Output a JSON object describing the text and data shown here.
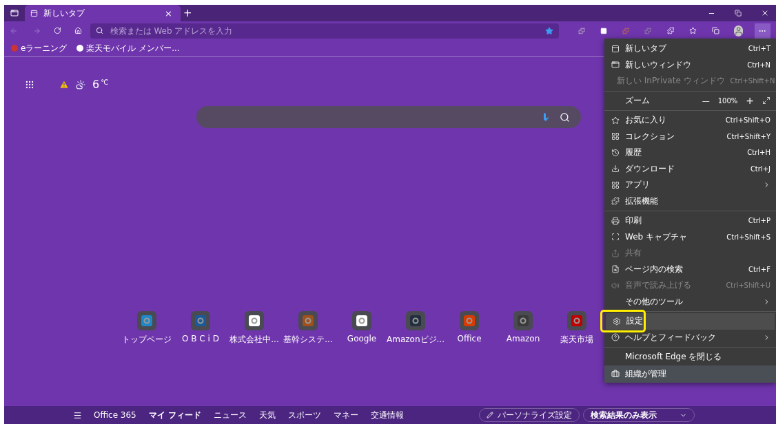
{
  "tab": {
    "title": "新しいタブ",
    "close": "×",
    "new": "+"
  },
  "address_bar": {
    "placeholder": "検索または Web アドレスを入力"
  },
  "favorites": [
    {
      "label": "eラーニング"
    },
    {
      "label": "楽天モバイル メンバー..."
    }
  ],
  "weather": {
    "temperature": "6",
    "unit": "℃"
  },
  "top_sites": [
    {
      "label": "トップページ",
      "color": "#1e88c8"
    },
    {
      "label": "O B C i D",
      "color": "#1a5a9a"
    },
    {
      "label": "株式会社中...",
      "color": "#ffffff"
    },
    {
      "label": "基幹システ...",
      "color": "#a0501a"
    },
    {
      "label": "Google",
      "color": "#ffffff"
    },
    {
      "label": "Amazonビジ...",
      "color": "#232f3e"
    },
    {
      "label": "Office",
      "color": "#d83b01"
    },
    {
      "label": "Amazon",
      "color": "#3a3a3a"
    },
    {
      "label": "楽天市場",
      "color": "#bf0000"
    }
  ],
  "menu": [
    {
      "kind": "item",
      "label": "新しいタブ",
      "shortcut": "Ctrl+T",
      "disabled": false,
      "selected": false
    },
    {
      "kind": "item",
      "label": "新しいウィンドウ",
      "shortcut": "Ctrl+N",
      "disabled": false,
      "selected": false
    },
    {
      "kind": "item",
      "label": "新しい InPrivate ウィンドウ",
      "shortcut": "Ctrl+Shift+N",
      "disabled": true,
      "selected": false
    },
    {
      "kind": "divider"
    },
    {
      "kind": "zoom",
      "label": "ズーム",
      "minus": "—",
      "value": "100%",
      "plus": "+"
    },
    {
      "kind": "divider"
    },
    {
      "kind": "item",
      "label": "お気に入り",
      "shortcut": "Ctrl+Shift+O",
      "disabled": false,
      "selected": false
    },
    {
      "kind": "item",
      "label": "コレクション",
      "shortcut": "Ctrl+Shift+Y",
      "disabled": false,
      "selected": false
    },
    {
      "kind": "item",
      "label": "履歴",
      "shortcut": "Ctrl+H",
      "disabled": false,
      "selected": false
    },
    {
      "kind": "item",
      "label": "ダウンロード",
      "shortcut": "Ctrl+J",
      "disabled": false,
      "selected": false
    },
    {
      "kind": "submenu",
      "label": "アプリ",
      "disabled": false,
      "selected": false
    },
    {
      "kind": "item",
      "label": "拡張機能",
      "disabled": false,
      "selected": false
    },
    {
      "kind": "divider"
    },
    {
      "kind": "item",
      "label": "印刷",
      "shortcut": "Ctrl+P",
      "disabled": false,
      "selected": false
    },
    {
      "kind": "item",
      "label": "Web キャプチャ",
      "shortcut": "Ctrl+Shift+S",
      "disabled": false,
      "selected": false
    },
    {
      "kind": "item",
      "label": "共有",
      "disabled": true,
      "selected": false
    },
    {
      "kind": "item",
      "label": "ページ内の検索",
      "shortcut": "Ctrl+F",
      "disabled": false,
      "selected": false
    },
    {
      "kind": "item",
      "label": "音声で読み上げる",
      "shortcut": "Ctrl+Shift+U",
      "disabled": true,
      "selected": false
    },
    {
      "kind": "submenu",
      "label": "その他のツール",
      "disabled": false,
      "selected": false
    },
    {
      "kind": "divider"
    },
    {
      "kind": "item",
      "label": "設定",
      "disabled": false,
      "selected": true
    },
    {
      "kind": "submenu",
      "label": "ヘルプとフィードバック",
      "disabled": false,
      "selected": false
    },
    {
      "kind": "divider"
    },
    {
      "kind": "item",
      "label": "Microsoft Edge を閉じる",
      "disabled": false,
      "selected": false
    },
    {
      "kind": "footer",
      "label": "組織が管理"
    }
  ],
  "feed_nav": [
    {
      "label": "Office 365",
      "selected": false
    },
    {
      "label": "マイ フィード",
      "selected": true
    },
    {
      "label": "ニュース",
      "selected": false
    },
    {
      "label": "天気",
      "selected": false
    },
    {
      "label": "スポーツ",
      "selected": false
    },
    {
      "label": "マネー",
      "selected": false
    },
    {
      "label": "交通情報",
      "selected": false
    }
  ],
  "personalize_button": "パーソナライズ設定",
  "layout_dropdown": "検索結果のみ表示"
}
